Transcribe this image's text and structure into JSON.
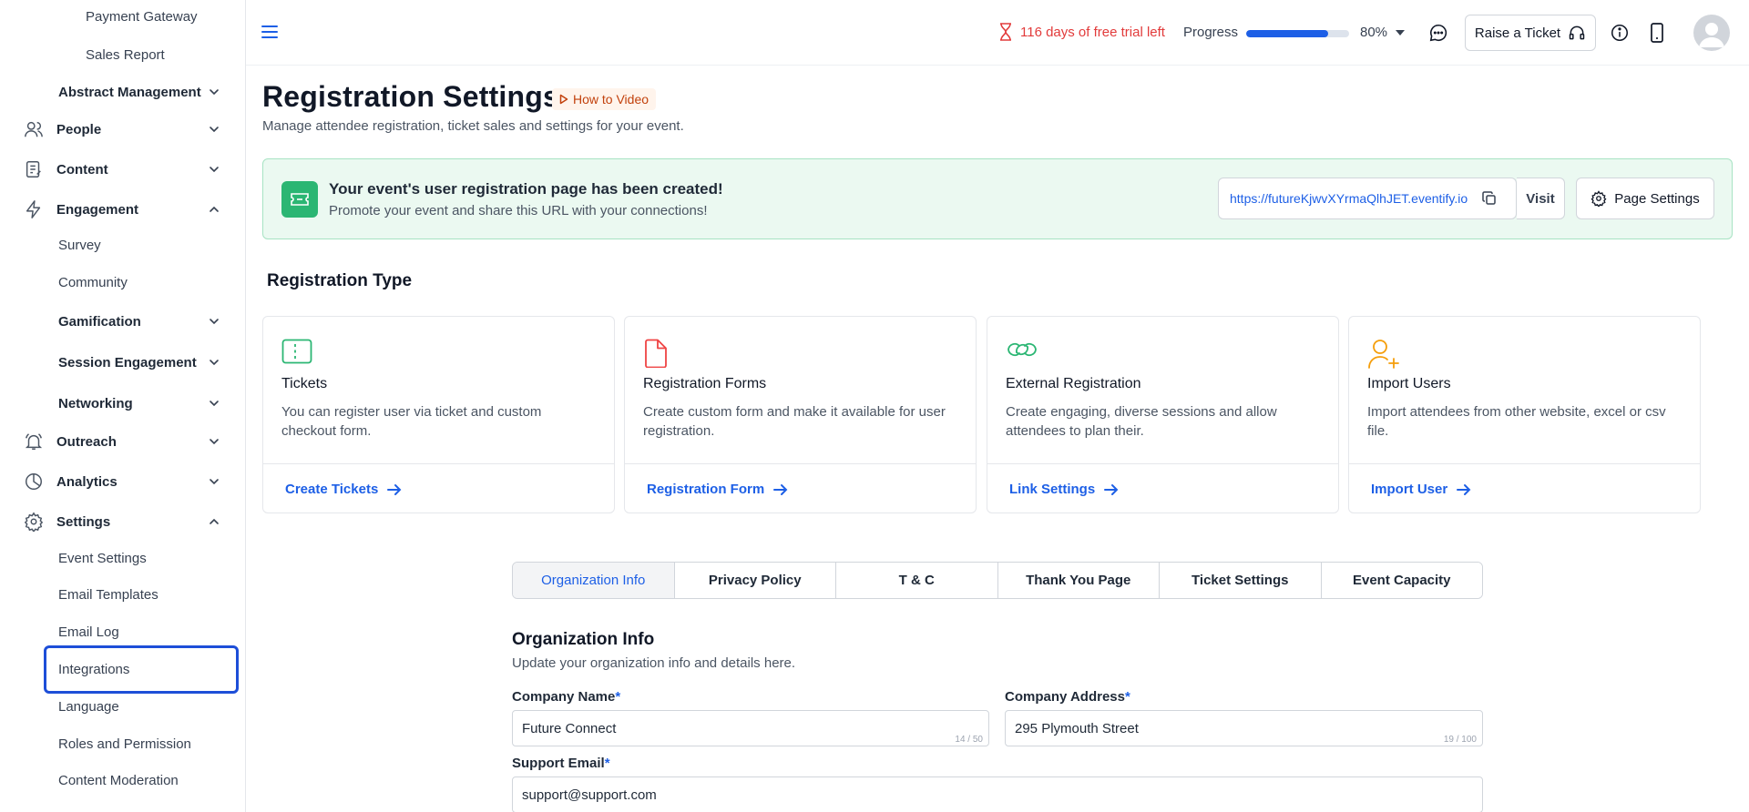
{
  "sidebar": {
    "payment_gateway": "Payment Gateway",
    "sales_report": "Sales Report",
    "abstract_management": "Abstract Management",
    "people": "People",
    "content": "Content",
    "engagement": "Engagement",
    "survey": "Survey",
    "community": "Community",
    "gamification": "Gamification",
    "session_engagement": "Session Engagement",
    "networking": "Networking",
    "outreach": "Outreach",
    "analytics": "Analytics",
    "settings": "Settings",
    "event_settings": "Event Settings",
    "email_templates": "Email Templates",
    "email_log": "Email Log",
    "integrations": "Integrations",
    "language": "Language",
    "roles_permission": "Roles and Permission",
    "content_moderation": "Content Moderation"
  },
  "topbar": {
    "trial_text": "116 days of free trial left",
    "progress_label": "Progress",
    "progress_percent": 80,
    "progress_text": "80%",
    "raise_ticket": "Raise a Ticket"
  },
  "header": {
    "title": "Registration Settings",
    "how_to_video": "How to Video",
    "subtitle": "Manage attendee registration, ticket sales and settings for your event."
  },
  "banner": {
    "title": "Your event's user registration page has been created!",
    "subtitle": "Promote your event and share this URL with your connections!",
    "url": "https://futureKjwvXYrmaQlhJET.eventify.io",
    "visit": "Visit",
    "page_settings": "Page Settings"
  },
  "registration_type": {
    "title": "Registration Type",
    "cards": [
      {
        "title": "Tickets",
        "desc": "You can register user via ticket and custom checkout form.",
        "link": "Create Tickets",
        "icon": "ticket-icon",
        "color": "#2bb673"
      },
      {
        "title": "Registration Forms",
        "desc": "Create custom form and make it available for user registration.",
        "link": "Registration Form",
        "icon": "document-icon",
        "color": "#ef4444"
      },
      {
        "title": "External Registration",
        "desc": "Create engaging, diverse sessions and allow attendees to plan their.",
        "link": "Link Settings",
        "icon": "link-icon",
        "color": "#2bb673"
      },
      {
        "title": "Import Users",
        "desc": "Import attendees from other website, excel or csv file.",
        "link": "Import User",
        "icon": "user-plus-icon",
        "color": "#f59e0b"
      }
    ]
  },
  "tabs": [
    "Organization Info",
    "Privacy Policy",
    "T & C",
    "Thank You Page",
    "Ticket Settings",
    "Event Capacity"
  ],
  "org_info": {
    "title": "Organization Info",
    "subtitle": "Update your organization info and details here.",
    "company_name_label": "Company Name",
    "company_name_value": "Future Connect",
    "company_name_count": "14 / 50",
    "company_address_label": "Company Address",
    "company_address_value": "295 Plymouth Street",
    "company_address_count": "19 / 100",
    "support_email_label": "Support Email",
    "support_email_value": "support@support.com",
    "required_mark": "*"
  },
  "colors": {
    "accent": "#1d5fe6",
    "success": "#2bb673",
    "danger": "#e23b3b"
  }
}
